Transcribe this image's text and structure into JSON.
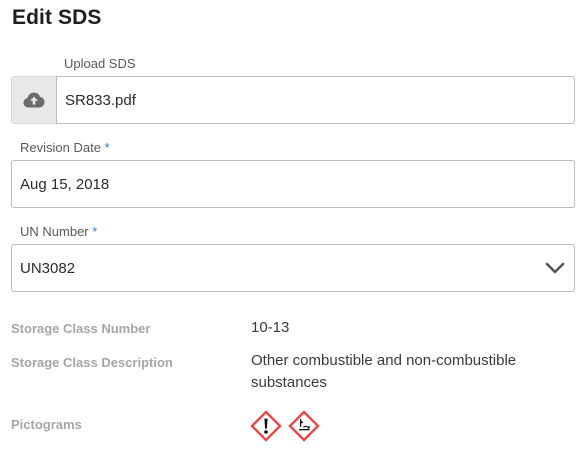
{
  "form": {
    "title": "Edit SDS",
    "upload": {
      "label": "Upload SDS",
      "value": "SR833.pdf",
      "icon": "cloud-upload-icon"
    },
    "revision_date": {
      "label": "Revision Date",
      "required_mark": "*",
      "value": "Aug 15, 2018"
    },
    "un_number": {
      "label": "UN Number",
      "required_mark": "*",
      "selected": "UN3082",
      "icon": "chevron-down-icon"
    }
  },
  "details": {
    "storage_class_number": {
      "label": "Storage Class Number",
      "value": "10-13"
    },
    "storage_class_description": {
      "label": "Storage Class Description",
      "value_line1": "Other combustible and non-combustible",
      "value_line2": "substances"
    },
    "pictograms": {
      "label": "Pictograms",
      "items": [
        {
          "name": "ghs07-exclamation-mark",
          "icon": "exclamation-pictogram-icon"
        },
        {
          "name": "ghs09-environment",
          "icon": "environment-pictogram-icon"
        }
      ],
      "colors": {
        "border": "#e8484b",
        "symbol": "#111111"
      }
    }
  }
}
